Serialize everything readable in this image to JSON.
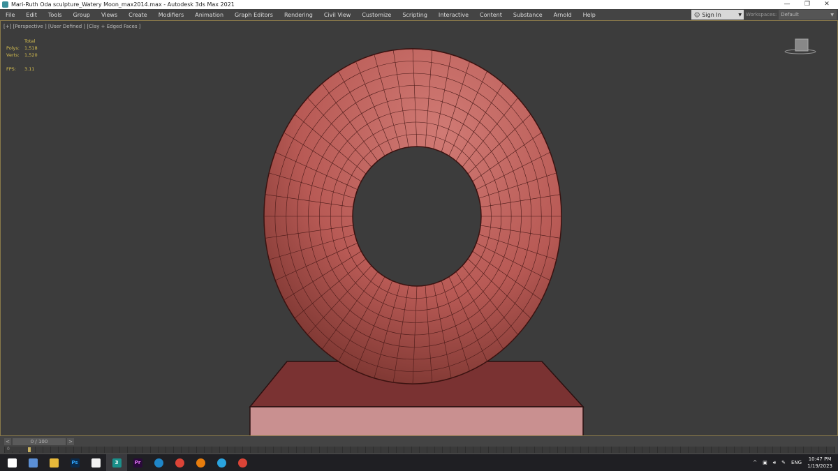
{
  "window": {
    "title": "Mari-Ruth Oda sculpture_Watery Moon_max2014.max - Autodesk 3ds Max 2021",
    "minimize": "—",
    "restore": "❐",
    "close": "✕"
  },
  "menu": [
    "File",
    "Edit",
    "Tools",
    "Group",
    "Views",
    "Create",
    "Modifiers",
    "Animation",
    "Graph Editors",
    "Rendering",
    "Civil View",
    "Customize",
    "Scripting",
    "Interactive",
    "Content",
    "Substance",
    "Arnold",
    "Help"
  ],
  "account": {
    "signin": "Sign In",
    "workspaces_label": "Workspaces:",
    "workspace": "Default"
  },
  "viewport": {
    "label": "[+] [Perspective ] [User Defined ] [Clay + Edged Faces ]",
    "stats": {
      "header": "Total",
      "polys_label": "Polys:",
      "polys": "1,518",
      "verts_label": "Verts:",
      "verts": "1,520",
      "fps_label": "FPS:",
      "fps": "3.11"
    },
    "colors": {
      "model": "#b85a55",
      "pedestal_top": "#7a3232",
      "pedestal_front": "#c99090"
    }
  },
  "timeline": {
    "prev": "<",
    "frame": "0 / 100",
    "next": ">",
    "ruler_start": "0"
  },
  "taskbar": {
    "apps": [
      {
        "icon": "windows-start-icon"
      },
      {
        "icon": "calculator-icon"
      },
      {
        "icon": "file-explorer-icon"
      },
      {
        "icon": "photoshop-icon",
        "text": "Ps"
      },
      {
        "icon": "notepad-icon"
      },
      {
        "icon": "3ds-max-icon",
        "text": "3"
      },
      {
        "icon": "premiere-icon",
        "text": "Pr"
      },
      {
        "icon": "edge-icon"
      },
      {
        "icon": "chrome-icon"
      },
      {
        "icon": "blender-icon"
      },
      {
        "icon": "telegram-icon"
      },
      {
        "icon": "chrome-icon"
      }
    ],
    "tray": {
      "lang": "ENG",
      "time": "10:47 PM",
      "date": "1/19/2023"
    }
  }
}
